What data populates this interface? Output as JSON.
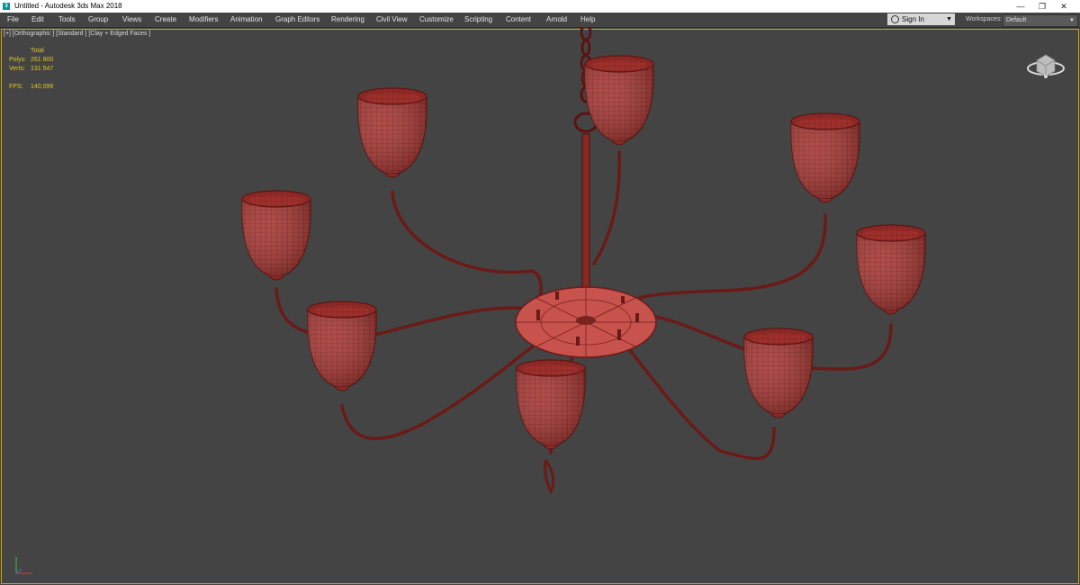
{
  "window": {
    "icon_letter": "3",
    "title": "Untitled - Autodesk 3ds Max 2018",
    "minimize": "—",
    "maximize": "❐",
    "close": "✕"
  },
  "menu": {
    "items": [
      "File",
      "Edit",
      "Tools",
      "Group",
      "Views",
      "Create",
      "Modifiers",
      "Animation",
      "Graph Editors",
      "Rendering",
      "Civil View",
      "Customize",
      "Scripting",
      "Content",
      "Arnold",
      "Help"
    ]
  },
  "signin": {
    "label": "Sign In",
    "icon": "user-icon"
  },
  "workspaces": {
    "label": "Workspaces:",
    "value": "Default"
  },
  "viewport": {
    "label": "[+] [Orthographic ] [Standard ] [Clay + Edged Faces ]",
    "stats": {
      "header": "Total",
      "polys_label": "Polys:",
      "polys_value": "261 800",
      "verts_label": "Verts:",
      "verts_value": "131 547",
      "fps_label": "FPS:",
      "fps_value": "140,099"
    }
  },
  "colors": {
    "viewport_bg": "#444444",
    "active_border": "#c9a600",
    "mesh": "#a5332f",
    "wire": "#521010"
  }
}
